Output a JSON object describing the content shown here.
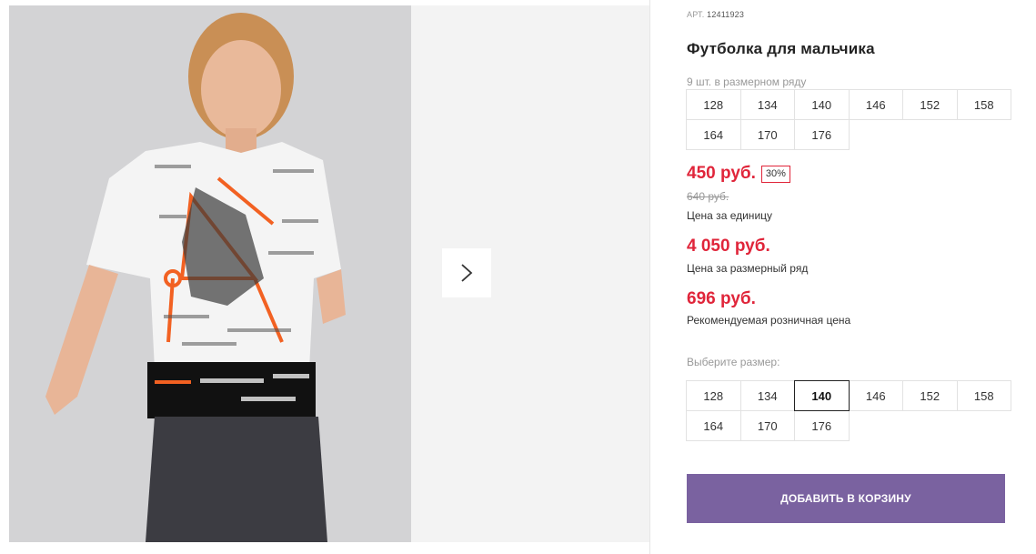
{
  "product": {
    "art_label": "АРТ.",
    "art_number": "12411923",
    "title": "Футболка для мальчика",
    "qty_note": "9 шт. в размерном ряду",
    "sizes_in_row": [
      "128",
      "134",
      "140",
      "146",
      "152",
      "158",
      "164",
      "170",
      "176"
    ],
    "price": {
      "current": "450 руб.",
      "discount": "30%",
      "old": "640 руб.",
      "unit_note": "Цена за единицу",
      "row_price": "4 050 руб.",
      "row_note": "Цена за размерный ряд",
      "rrp": "696 руб.",
      "rrp_note": "Рекомендуемая розничная цена"
    },
    "choose_size_label": "Выберите размер:",
    "size_options": [
      "128",
      "134",
      "140",
      "146",
      "152",
      "158",
      "164",
      "170",
      "176"
    ],
    "selected_size": "140",
    "add_to_cart_label": "ДОБАВИТЬ В КОРЗИНУ"
  },
  "colors": {
    "accent": "#7a62a0",
    "price_red": "#e0253a"
  },
  "icons": {
    "gallery_next": "chevron-right-icon"
  }
}
